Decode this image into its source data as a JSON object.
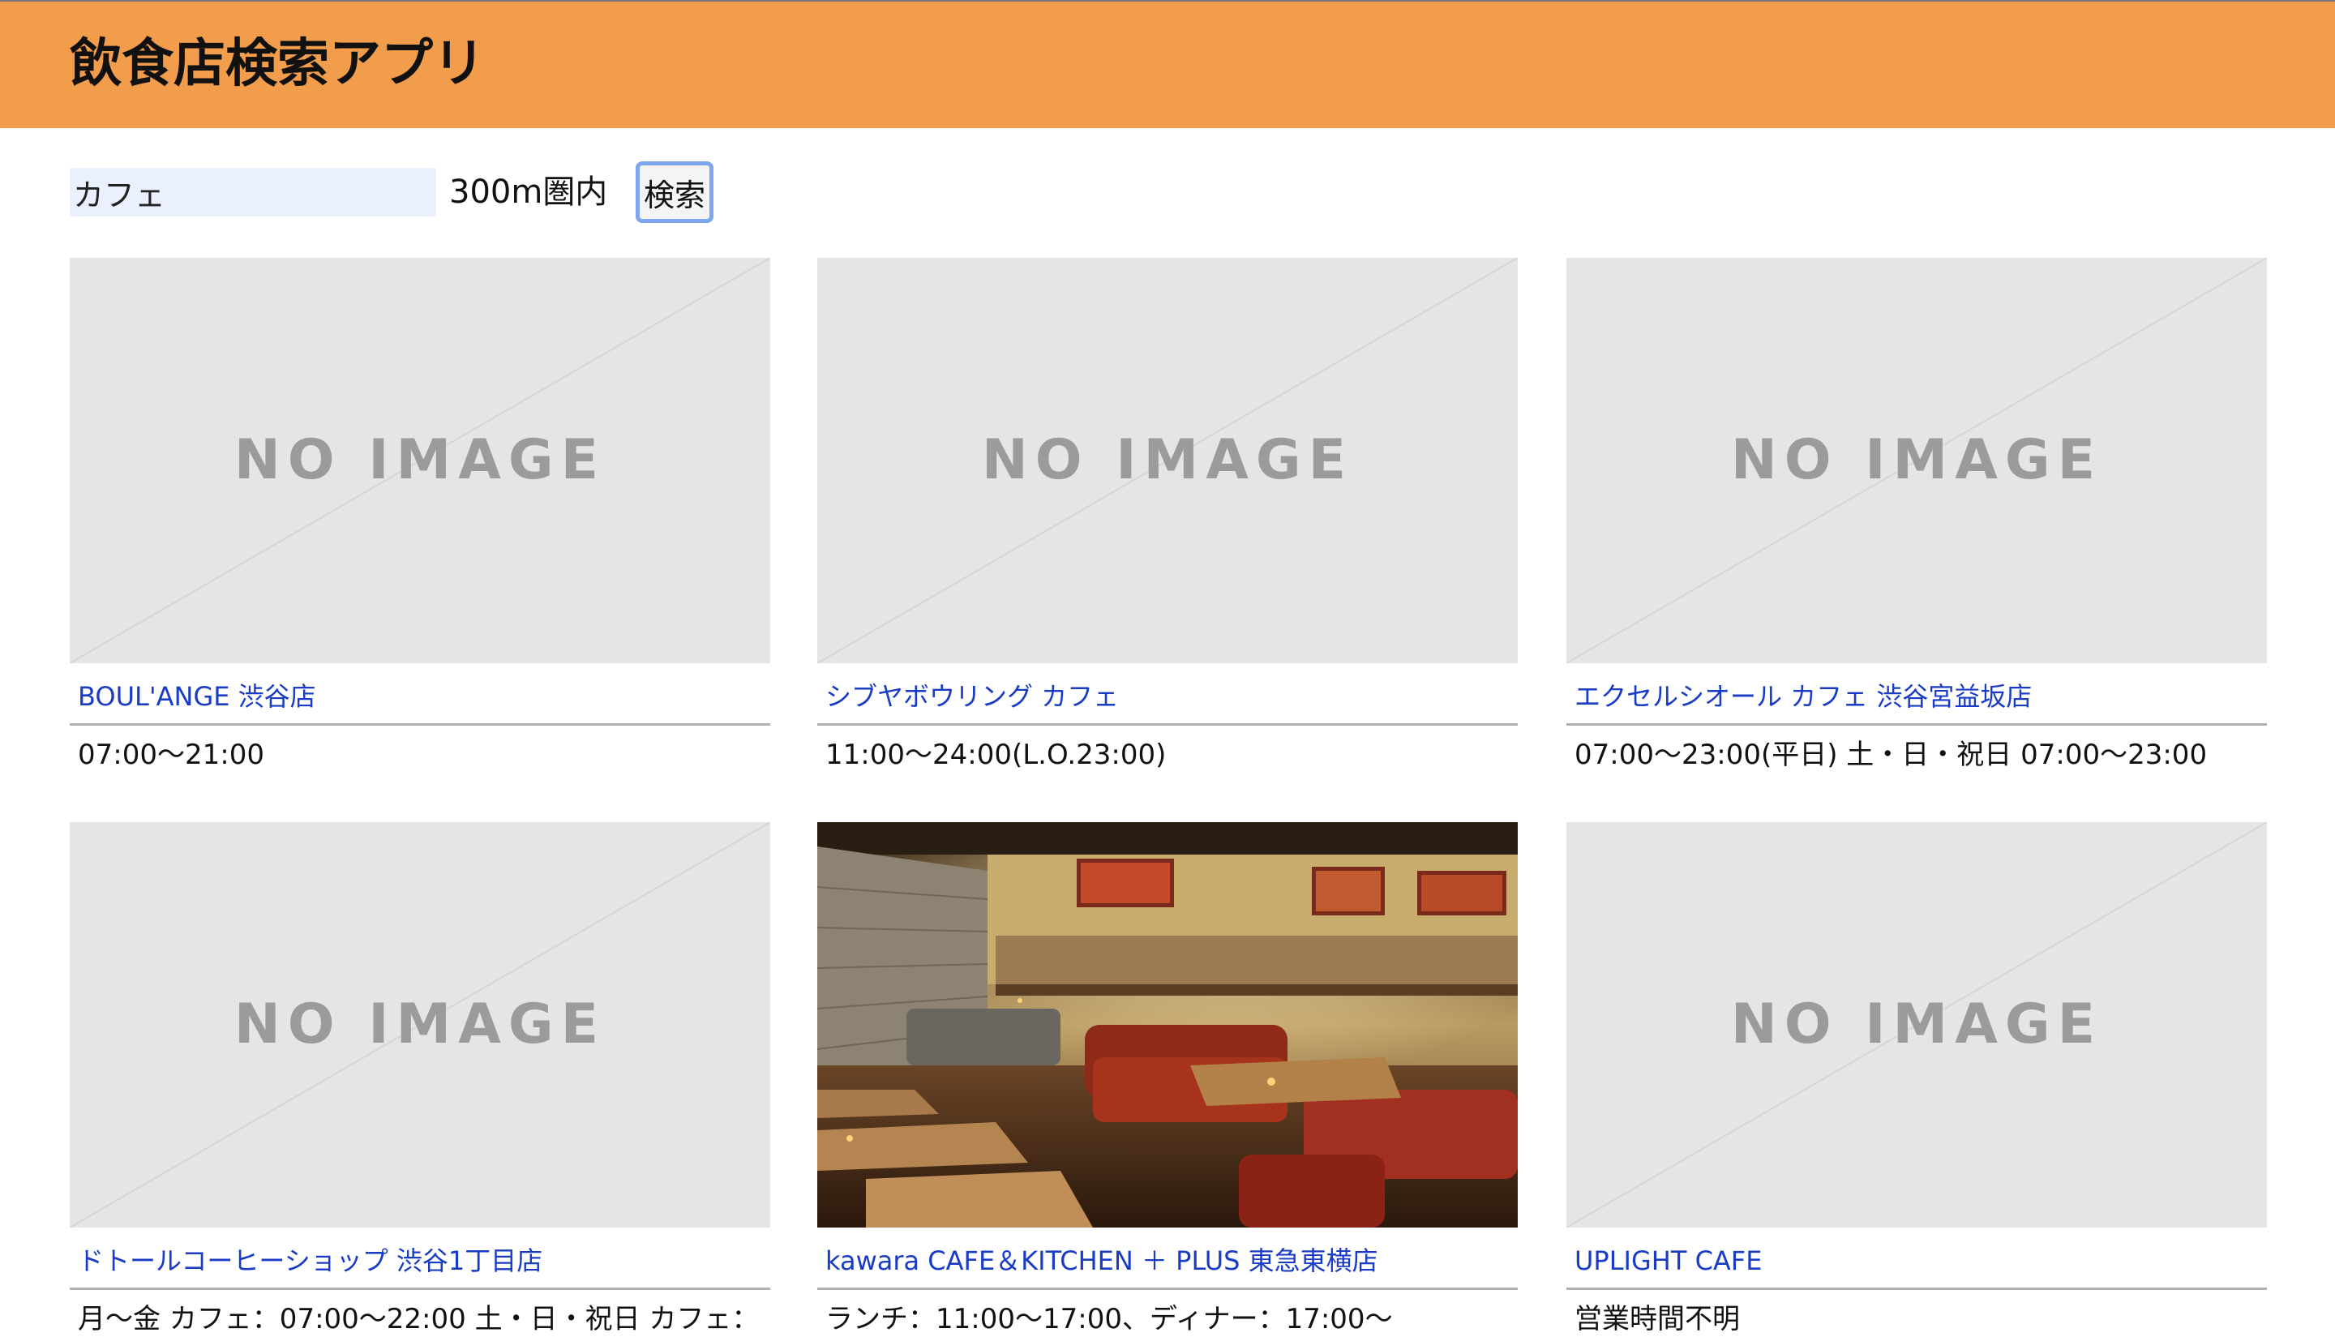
{
  "header": {
    "title": "飲食店検索アプリ",
    "bg_color": "#f29d4c"
  },
  "search": {
    "keyword_value": "カフェ",
    "range_label": "300m圏内",
    "button_label": "検索"
  },
  "no_image_text": "NO IMAGE",
  "shops": [
    {
      "name": "BOUL'ANGE 渋谷店",
      "hours": "07:00〜21:00",
      "has_image": false
    },
    {
      "name": "シブヤボウリング カフェ",
      "hours": "11:00〜24:00(L.O.23:00)",
      "has_image": false
    },
    {
      "name": "エクセルシオール カフェ 渋谷宮益坂店",
      "hours": "07:00〜23:00(平日) 土・日・祝日 07:00〜23:00",
      "has_image": false
    },
    {
      "name": "ドトールコーヒーショップ 渋谷1丁目店",
      "hours": "月〜金 カフェ：07:00〜22:00 土・日・祝日 カフェ：",
      "has_image": false
    },
    {
      "name": "kawara CAFE＆KITCHEN ＋ PLUS 東急東横店",
      "hours": "ランチ：11:00〜17:00、ディナー：17:00〜",
      "has_image": true
    },
    {
      "name": "UPLIGHT CAFE",
      "hours": "営業時間不明",
      "has_image": false
    }
  ]
}
